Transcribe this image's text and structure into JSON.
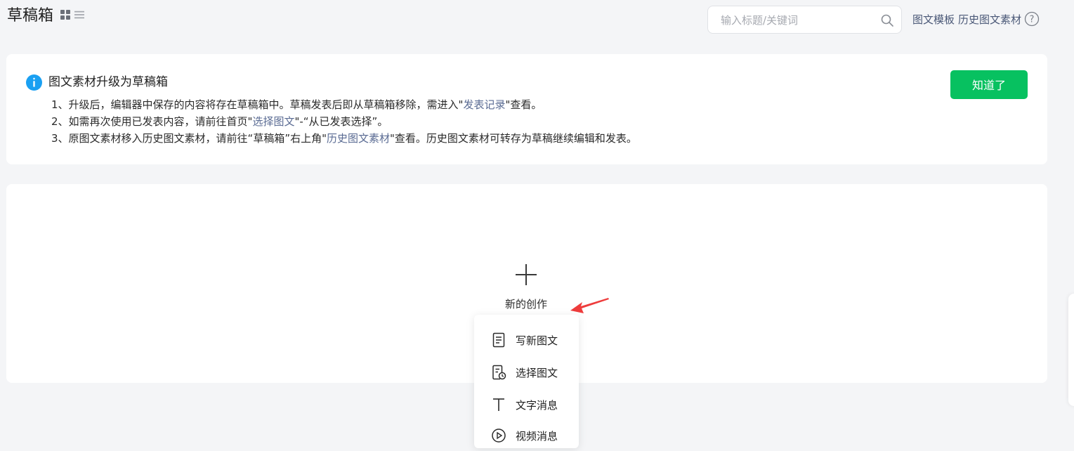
{
  "header": {
    "title": "草稿箱",
    "search_placeholder": "输入标题/关键词",
    "links": [
      "图文模板",
      "历史图文素材"
    ]
  },
  "notice": {
    "title": "图文素材升级为草稿箱",
    "line1_pre": "1、升级后，编辑器中保存的内容将存在草稿箱中。草稿发表后即从草稿箱移除，需进入\"",
    "line1_link": "发表记录",
    "line1_post": "\"查看。",
    "line2_pre": "2、如需再次使用已发表内容，请前往首页\"",
    "line2_link": "选择图文",
    "line2_post": "\"-“从已发表选择”。",
    "line3_pre": "3、原图文素材移入历史图文素材，请前往“草稿箱”右上角\"",
    "line3_link": "历史图文素材",
    "line3_post": "\"查看。历史图文素材可转存为草稿继续编辑和发表。",
    "button": "知道了"
  },
  "create": {
    "label": "新的创作",
    "menu": [
      {
        "label": "写新图文",
        "icon": "document-icon"
      },
      {
        "label": "选择图文",
        "icon": "document-clock-icon"
      },
      {
        "label": "文字消息",
        "icon": "text-t-icon"
      },
      {
        "label": "视频消息",
        "icon": "play-circle-icon"
      }
    ]
  },
  "colors": {
    "accent_green": "#07c160",
    "link_blue": "#5a6b93",
    "info_blue": "#1aa0f2",
    "arrow_red": "#ee3c3c"
  }
}
